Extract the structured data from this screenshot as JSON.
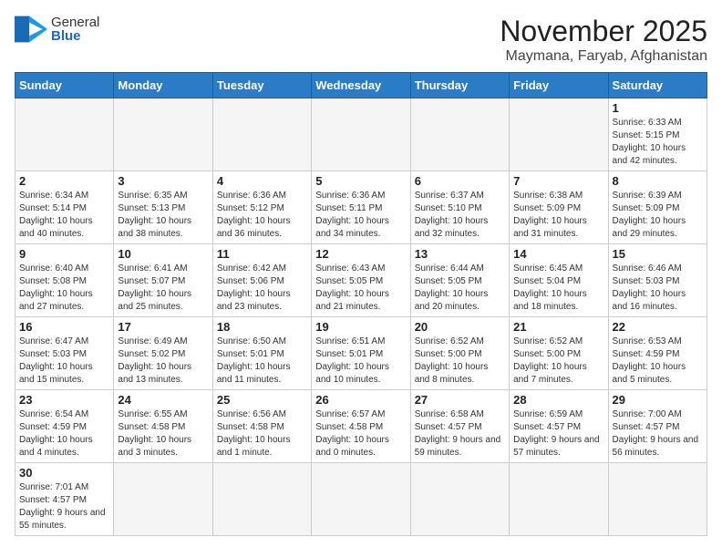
{
  "logo": {
    "line1": "General",
    "line2": "Blue"
  },
  "title": "November 2025",
  "location": "Maymana, Faryab, Afghanistan",
  "days_of_week": [
    "Sunday",
    "Monday",
    "Tuesday",
    "Wednesday",
    "Thursday",
    "Friday",
    "Saturday"
  ],
  "weeks": [
    [
      {
        "day": "",
        "info": ""
      },
      {
        "day": "",
        "info": ""
      },
      {
        "day": "",
        "info": ""
      },
      {
        "day": "",
        "info": ""
      },
      {
        "day": "",
        "info": ""
      },
      {
        "day": "",
        "info": ""
      },
      {
        "day": "1",
        "info": "Sunrise: 6:33 AM\nSunset: 5:15 PM\nDaylight: 10 hours and 42 minutes."
      }
    ],
    [
      {
        "day": "2",
        "info": "Sunrise: 6:34 AM\nSunset: 5:14 PM\nDaylight: 10 hours and 40 minutes."
      },
      {
        "day": "3",
        "info": "Sunrise: 6:35 AM\nSunset: 5:13 PM\nDaylight: 10 hours and 38 minutes."
      },
      {
        "day": "4",
        "info": "Sunrise: 6:36 AM\nSunset: 5:12 PM\nDaylight: 10 hours and 36 minutes."
      },
      {
        "day": "5",
        "info": "Sunrise: 6:36 AM\nSunset: 5:11 PM\nDaylight: 10 hours and 34 minutes."
      },
      {
        "day": "6",
        "info": "Sunrise: 6:37 AM\nSunset: 5:10 PM\nDaylight: 10 hours and 32 minutes."
      },
      {
        "day": "7",
        "info": "Sunrise: 6:38 AM\nSunset: 5:09 PM\nDaylight: 10 hours and 31 minutes."
      },
      {
        "day": "8",
        "info": "Sunrise: 6:39 AM\nSunset: 5:09 PM\nDaylight: 10 hours and 29 minutes."
      }
    ],
    [
      {
        "day": "9",
        "info": "Sunrise: 6:40 AM\nSunset: 5:08 PM\nDaylight: 10 hours and 27 minutes."
      },
      {
        "day": "10",
        "info": "Sunrise: 6:41 AM\nSunset: 5:07 PM\nDaylight: 10 hours and 25 minutes."
      },
      {
        "day": "11",
        "info": "Sunrise: 6:42 AM\nSunset: 5:06 PM\nDaylight: 10 hours and 23 minutes."
      },
      {
        "day": "12",
        "info": "Sunrise: 6:43 AM\nSunset: 5:05 PM\nDaylight: 10 hours and 21 minutes."
      },
      {
        "day": "13",
        "info": "Sunrise: 6:44 AM\nSunset: 5:05 PM\nDaylight: 10 hours and 20 minutes."
      },
      {
        "day": "14",
        "info": "Sunrise: 6:45 AM\nSunset: 5:04 PM\nDaylight: 10 hours and 18 minutes."
      },
      {
        "day": "15",
        "info": "Sunrise: 6:46 AM\nSunset: 5:03 PM\nDaylight: 10 hours and 16 minutes."
      }
    ],
    [
      {
        "day": "16",
        "info": "Sunrise: 6:47 AM\nSunset: 5:03 PM\nDaylight: 10 hours and 15 minutes."
      },
      {
        "day": "17",
        "info": "Sunrise: 6:49 AM\nSunset: 5:02 PM\nDaylight: 10 hours and 13 minutes."
      },
      {
        "day": "18",
        "info": "Sunrise: 6:50 AM\nSunset: 5:01 PM\nDaylight: 10 hours and 11 minutes."
      },
      {
        "day": "19",
        "info": "Sunrise: 6:51 AM\nSunset: 5:01 PM\nDaylight: 10 hours and 10 minutes."
      },
      {
        "day": "20",
        "info": "Sunrise: 6:52 AM\nSunset: 5:00 PM\nDaylight: 10 hours and 8 minutes."
      },
      {
        "day": "21",
        "info": "Sunrise: 6:52 AM\nSunset: 5:00 PM\nDaylight: 10 hours and 7 minutes."
      },
      {
        "day": "22",
        "info": "Sunrise: 6:53 AM\nSunset: 4:59 PM\nDaylight: 10 hours and 5 minutes."
      }
    ],
    [
      {
        "day": "23",
        "info": "Sunrise: 6:54 AM\nSunset: 4:59 PM\nDaylight: 10 hours and 4 minutes."
      },
      {
        "day": "24",
        "info": "Sunrise: 6:55 AM\nSunset: 4:58 PM\nDaylight: 10 hours and 3 minutes."
      },
      {
        "day": "25",
        "info": "Sunrise: 6:56 AM\nSunset: 4:58 PM\nDaylight: 10 hours and 1 minute."
      },
      {
        "day": "26",
        "info": "Sunrise: 6:57 AM\nSunset: 4:58 PM\nDaylight: 10 hours and 0 minutes."
      },
      {
        "day": "27",
        "info": "Sunrise: 6:58 AM\nSunset: 4:57 PM\nDaylight: 9 hours and 59 minutes."
      },
      {
        "day": "28",
        "info": "Sunrise: 6:59 AM\nSunset: 4:57 PM\nDaylight: 9 hours and 57 minutes."
      },
      {
        "day": "29",
        "info": "Sunrise: 7:00 AM\nSunset: 4:57 PM\nDaylight: 9 hours and 56 minutes."
      }
    ],
    [
      {
        "day": "30",
        "info": "Sunrise: 7:01 AM\nSunset: 4:57 PM\nDaylight: 9 hours and 55 minutes."
      },
      {
        "day": "",
        "info": ""
      },
      {
        "day": "",
        "info": ""
      },
      {
        "day": "",
        "info": ""
      },
      {
        "day": "",
        "info": ""
      },
      {
        "day": "",
        "info": ""
      },
      {
        "day": "",
        "info": ""
      }
    ]
  ]
}
